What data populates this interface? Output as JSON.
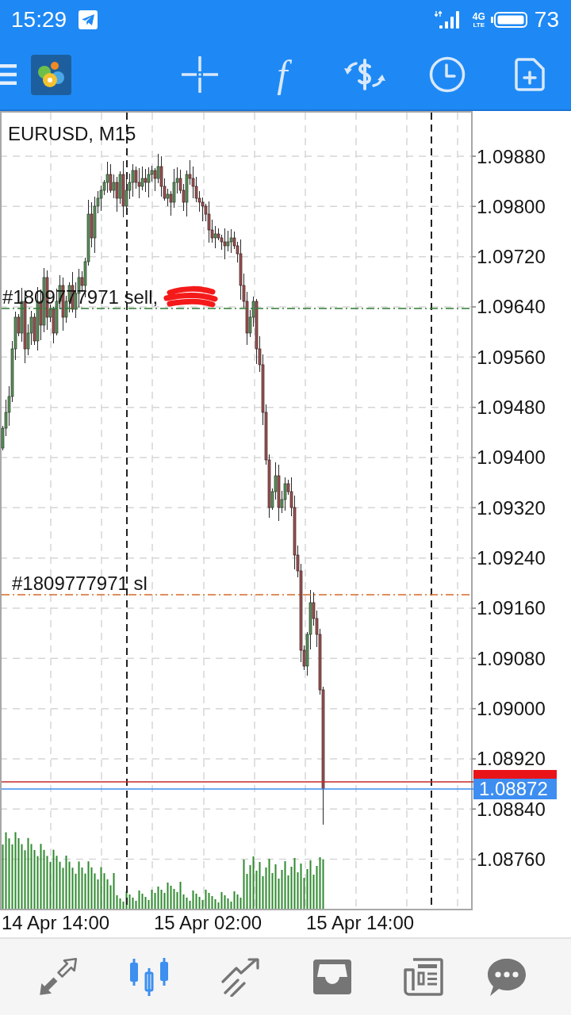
{
  "status_bar": {
    "time": "15:29",
    "network": "4G",
    "network_sub": "LTE",
    "battery": "73"
  },
  "toolbar": {
    "function_symbol": "f"
  },
  "chart": {
    "title": "EURUSD, M15",
    "price_axis": [
      "1.09880",
      "1.09800",
      "1.09720",
      "1.09640",
      "1.09560",
      "1.09480",
      "1.09400",
      "1.09320",
      "1.09240",
      "1.09160",
      "1.09080",
      "1.09000",
      "1.08920",
      "1.08840",
      "1.08760"
    ],
    "time_axis": [
      "14 Apr 14:00",
      "15 Apr 02:00",
      "15 Apr 14:00"
    ],
    "orders": [
      {
        "kind": "entry",
        "label": "#1809777971 sell,",
        "redacted": true
      },
      {
        "kind": "stop_loss",
        "label": "#1809777971 sl",
        "redacted": false
      }
    ],
    "bid_price": "1.08872"
  },
  "bottom_nav": [
    {
      "selected": false
    },
    {
      "selected": true
    },
    {
      "selected": false
    },
    {
      "selected": false
    },
    {
      "selected": false
    },
    {
      "selected": false
    }
  ]
}
